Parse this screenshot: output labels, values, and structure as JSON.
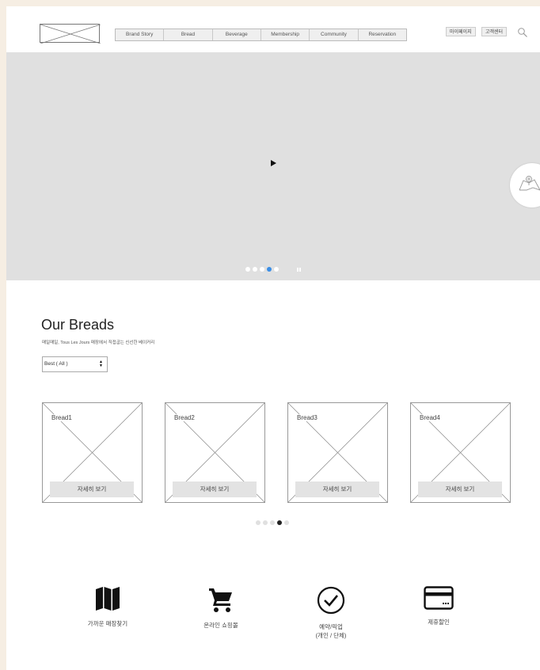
{
  "header": {
    "logo_alt": "",
    "nav": [
      "Brand Story",
      "Bread",
      "Beverage",
      "Membership",
      "Community",
      "Reservation"
    ],
    "mypage_label": "마이페이지",
    "customer_center_label": "고객센터",
    "search_icon": "search-icon"
  },
  "hero": {
    "play_icon": "play-icon",
    "slide_count": 5,
    "active_slide": 4,
    "pause_icon": "pause-icon",
    "floating_icon": "map-icon"
  },
  "breads": {
    "title": "Our Breads",
    "subtitle": "매일매일, Tous Les Jours 매장에서 직접굽는 신선한 베이커리",
    "filter_value": "Best ( All )",
    "items": [
      {
        "name": "Bread1",
        "button": "자세히 보기"
      },
      {
        "name": "Bread2",
        "button": "자세히 보기"
      },
      {
        "name": "Bread3",
        "button": "자세히 보기"
      },
      {
        "name": "Bread4",
        "button": "자세히 보기"
      }
    ],
    "pagination_count": 5,
    "pagination_active": 4
  },
  "features": [
    {
      "icon": "map-icon",
      "label": "가까운 매장찾기"
    },
    {
      "icon": "cart-icon",
      "label": "온라인 쇼핑몰"
    },
    {
      "icon": "check-circle-icon",
      "label": "예약/픽업\n(개인 / 단체)"
    },
    {
      "icon": "credit-card-icon",
      "label": "제휴할인"
    }
  ],
  "colors": {
    "background": "#f6eee3",
    "hero": "#e0e0e0",
    "active_dot": "#3a8ee6"
  }
}
